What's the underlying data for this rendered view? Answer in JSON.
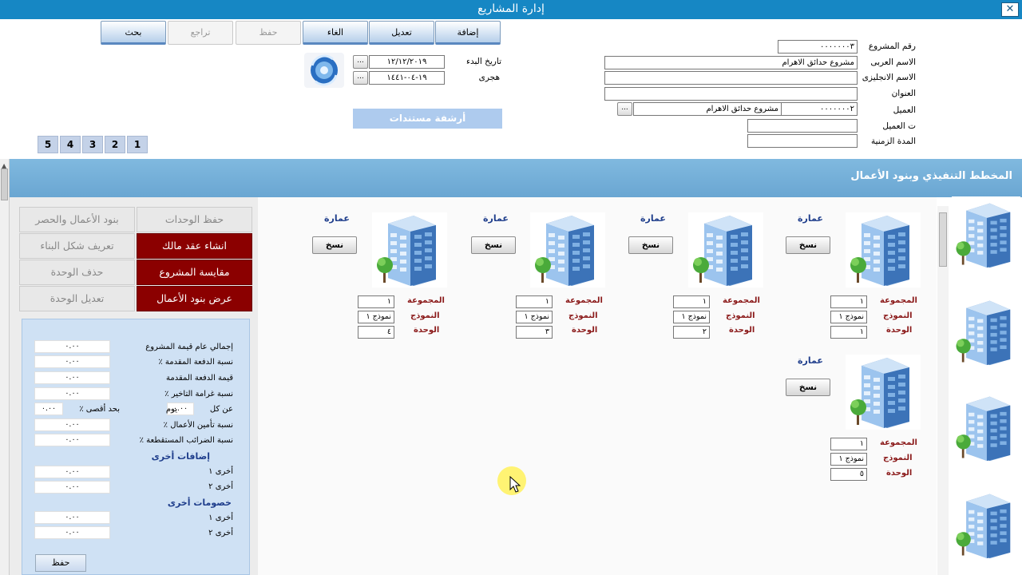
{
  "window": {
    "title": "إدارة المشاريع",
    "close_glyph": "✕"
  },
  "toolbar": {
    "add": "إضافة",
    "edit": "تعديل",
    "cancel": "الغاء",
    "save": "حفظ",
    "undo": "تراجع",
    "search": "بحث"
  },
  "project": {
    "number_label": "رقم المشروع",
    "number_value": "٠٠٠٠٠٠٠٣",
    "arabic_name_label": "الاسم العربى",
    "arabic_name_value": "مشروع حدائق الاهرام",
    "english_name_label": "الاسم الانجليزى",
    "english_name_value": "",
    "address_label": "العنوان",
    "address_value": "",
    "client_label": "العميل",
    "client_code": "٠٠٠٠٠٠٠٢",
    "client_name": "مشروع حدائق الاهرام",
    "client_phone_label": "ت العميل",
    "client_phone_value": "",
    "duration_label": "المدة الزمنية",
    "duration_value": "",
    "start_date_label": "تاريخ البدء",
    "start_date_value": "١٢/١٢/٢٠١٩",
    "hijri_label": "هجرى",
    "hijri_value": "١٩-٠٤-١٤٤١",
    "browse_glyph": "..."
  },
  "archive_button": "أرشفة مستندات",
  "page_tabs": [
    "1",
    "2",
    "3",
    "4",
    "5"
  ],
  "section_title": "المخطط التنفيذي وبنود الأعمال",
  "actions": {
    "save_units": "حفظ الوحدات",
    "items_and_count": "بنود الأعمال والحصر",
    "create_owner_contract": "انشاء عقد مالك",
    "define_building_shape": "تعريف شكل البناء",
    "project_measurement": "مقايسة المشروع",
    "delete_unit": "حذف الوحدة",
    "show_work_items": "عرض بنود الأعمال",
    "edit_unit": "تعديل الوحدة"
  },
  "finance": {
    "total_value_label": "إجمالي عام قيمة المشروع",
    "total_value": "٠.٠٠",
    "advance_pct_label": "نسبة الدفعة المقدمة ٪",
    "advance_pct": "٠.٠٠",
    "advance_value_label": "قيمة الدفعة المقدمة",
    "advance_value": "٠.٠٠",
    "delay_fine_label": "نسبة غرامة التاخير ٪",
    "delay_fine": "٠.٠٠",
    "per_label": "عن كل",
    "per_value": "٠.٠٠",
    "day_label": "يوم",
    "max_label": "بحد أقصى ٪",
    "max_value": "٠.٠٠",
    "works_insurance_label": "نسبة تأمين الأعمال ٪",
    "works_insurance": "٠.٠٠",
    "tax_label": "نسبة الضرائب المستقطعة ٪",
    "tax": "٠.٠٠",
    "other_additions_head": "إضافات أخرى",
    "other1_label": "أخرى ١",
    "other1": "٠.٠٠",
    "other2_label": "أخرى ٢",
    "other2": "٠.٠٠",
    "other_discounts_head": "خصومات أخرى",
    "disc1_label": "أخرى ١",
    "disc1": "٠.٠٠",
    "disc2_label": "أخرى ٢",
    "disc2": "٠.٠٠",
    "save_button": "حفظ"
  },
  "unit_labels": {
    "building": "عمارة",
    "copy": "نسخ",
    "group": "المجموعة",
    "model": "النموذج",
    "unit": "الوحدة"
  },
  "units": [
    {
      "group": "١",
      "model": "نموذج ١",
      "unit": "١"
    },
    {
      "group": "١",
      "model": "نموذج ١",
      "unit": "٢"
    },
    {
      "group": "١",
      "model": "نموذج ١",
      "unit": "٣"
    },
    {
      "group": "١",
      "model": "نموذج ١",
      "unit": "٤"
    },
    {
      "group": "١",
      "model": "نموذج ١",
      "unit": "٥"
    }
  ],
  "colors": {
    "titlebar": "#1687c4",
    "section": "#7db6dc",
    "action_red": "#8b0000",
    "unit_label": "#8b1a1a",
    "building_title": "#1f3e8c"
  }
}
